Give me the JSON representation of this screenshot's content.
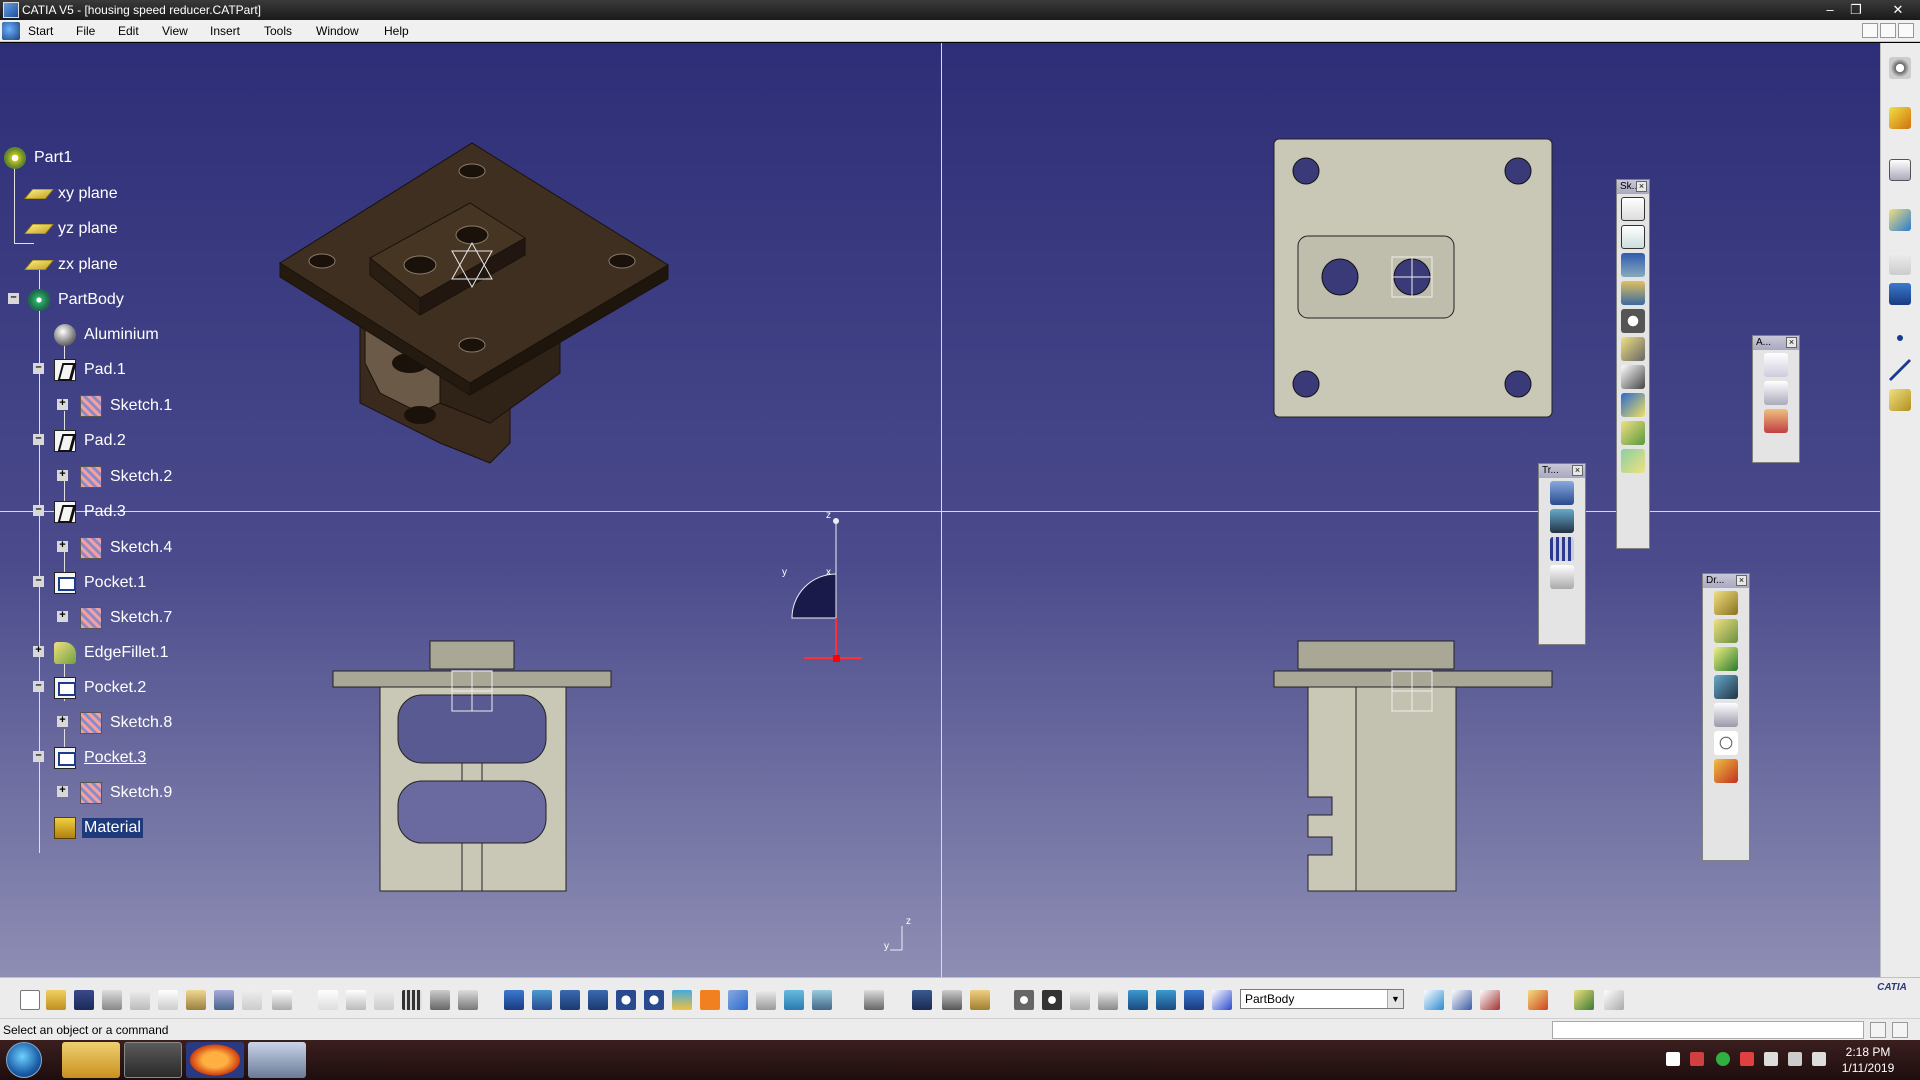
{
  "window": {
    "title": "CATIA V5 - [housing speed reducer.CATPart]",
    "controls": [
      "–",
      "❐",
      "✕"
    ]
  },
  "menu": {
    "items": [
      "Start",
      "File",
      "Edit",
      "View",
      "Insert",
      "Tools",
      "Window",
      "Help"
    ]
  },
  "tree": {
    "nodes": [
      {
        "label": "Part1",
        "icon": "part-icon"
      },
      {
        "label": "xy plane",
        "icon": "plane-icon"
      },
      {
        "label": "yz plane",
        "icon": "plane-icon"
      },
      {
        "label": "zx plane",
        "icon": "plane-icon"
      },
      {
        "label": "PartBody",
        "icon": "body-icon"
      },
      {
        "label": "Aluminium",
        "icon": "material-sphere-icon"
      },
      {
        "label": "Pad.1",
        "icon": "pad-icon"
      },
      {
        "label": "Sketch.1",
        "icon": "sketch-icon"
      },
      {
        "label": "Pad.2",
        "icon": "pad-icon"
      },
      {
        "label": "Sketch.2",
        "icon": "sketch-icon"
      },
      {
        "label": "Pad.3",
        "icon": "pad-icon"
      },
      {
        "label": "Sketch.4",
        "icon": "sketch-icon"
      },
      {
        "label": "Pocket.1",
        "icon": "pocket-icon"
      },
      {
        "label": "Sketch.7",
        "icon": "sketch-icon"
      },
      {
        "label": "EdgeFillet.1",
        "icon": "fillet-icon"
      },
      {
        "label": "Pocket.2",
        "icon": "pocket-icon"
      },
      {
        "label": "Sketch.8",
        "icon": "sketch-icon"
      },
      {
        "label": "Pocket.3",
        "icon": "pocket-icon"
      },
      {
        "label": "Sketch.9",
        "icon": "sketch-icon"
      },
      {
        "label": "Material",
        "icon": "material-icon"
      }
    ]
  },
  "floating_toolbars": {
    "sketch": {
      "title": "Sk..."
    },
    "annotations": {
      "title": "A..."
    },
    "transform": {
      "title": "Tr..."
    },
    "dressup": {
      "title": "Dr..."
    }
  },
  "axis": {
    "compass_x": "x",
    "compass_y": "y",
    "compass_z": "z",
    "corner_y": "y",
    "corner_z": "z"
  },
  "bottom_toolbar": {
    "current_body": "PartBody",
    "close_glyph": "×",
    "brand": "CATIA"
  },
  "status": {
    "message": "Select an object or a command"
  },
  "taskbar": {
    "time": "2:18 PM",
    "date": "1/11/2019"
  },
  "colors": {
    "viewport_top": "#2e2e78",
    "viewport_bottom": "#8e8eb4",
    "part_dark": "#3f2f20",
    "part_light": "#cfcbb5"
  }
}
